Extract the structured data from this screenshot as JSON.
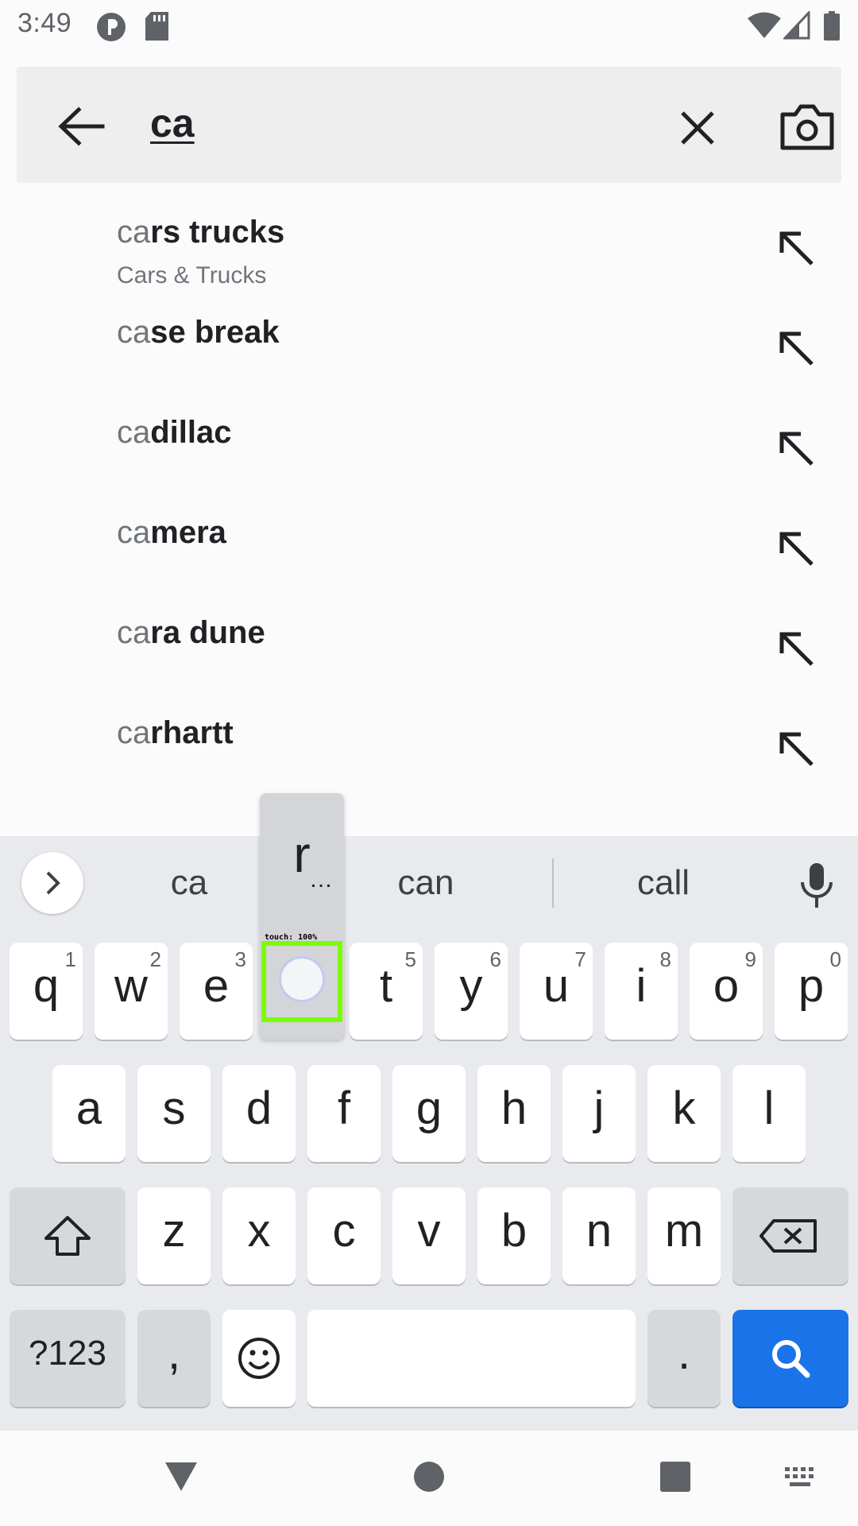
{
  "status_bar": {
    "time": "3:49",
    "icons": [
      "p-icon",
      "sd-card-icon",
      "wifi-icon",
      "signal-icon",
      "battery-icon"
    ]
  },
  "search": {
    "query": "ca",
    "icons": {
      "back": "arrow-left-icon",
      "clear": "close-icon",
      "camera": "camera-icon"
    }
  },
  "suggestions": [
    {
      "prefix": "ca",
      "rest": "rs trucks",
      "subtitle": "Cars & Trucks"
    },
    {
      "prefix": "ca",
      "rest": "se break",
      "subtitle": ""
    },
    {
      "prefix": "ca",
      "rest": "dillac",
      "subtitle": ""
    },
    {
      "prefix": "ca",
      "rest": "mera",
      "subtitle": ""
    },
    {
      "prefix": "ca",
      "rest": "ra dune",
      "subtitle": ""
    },
    {
      "prefix": "ca",
      "rest": "rhartt",
      "subtitle": ""
    }
  ],
  "keyboard": {
    "strip_words": [
      "ca",
      "can",
      "call"
    ],
    "row1": [
      {
        "label": "q",
        "hint": "1"
      },
      {
        "label": "w",
        "hint": "2"
      },
      {
        "label": "e",
        "hint": "3"
      },
      {
        "label": "r",
        "hint": "4"
      },
      {
        "label": "t",
        "hint": "5"
      },
      {
        "label": "y",
        "hint": "6"
      },
      {
        "label": "u",
        "hint": "7"
      },
      {
        "label": "i",
        "hint": "8"
      },
      {
        "label": "o",
        "hint": "9"
      },
      {
        "label": "p",
        "hint": "0"
      }
    ],
    "row2": [
      "a",
      "s",
      "d",
      "f",
      "g",
      "h",
      "j",
      "k",
      "l"
    ],
    "row3": [
      "z",
      "x",
      "c",
      "v",
      "b",
      "n",
      "m"
    ],
    "symbols_key": "?123",
    "comma_key": ",",
    "period_key": ".",
    "popup": {
      "letter": "r",
      "more": "…"
    },
    "touch_label": "touch: 100%",
    "accent_color": "#1a73e8"
  }
}
